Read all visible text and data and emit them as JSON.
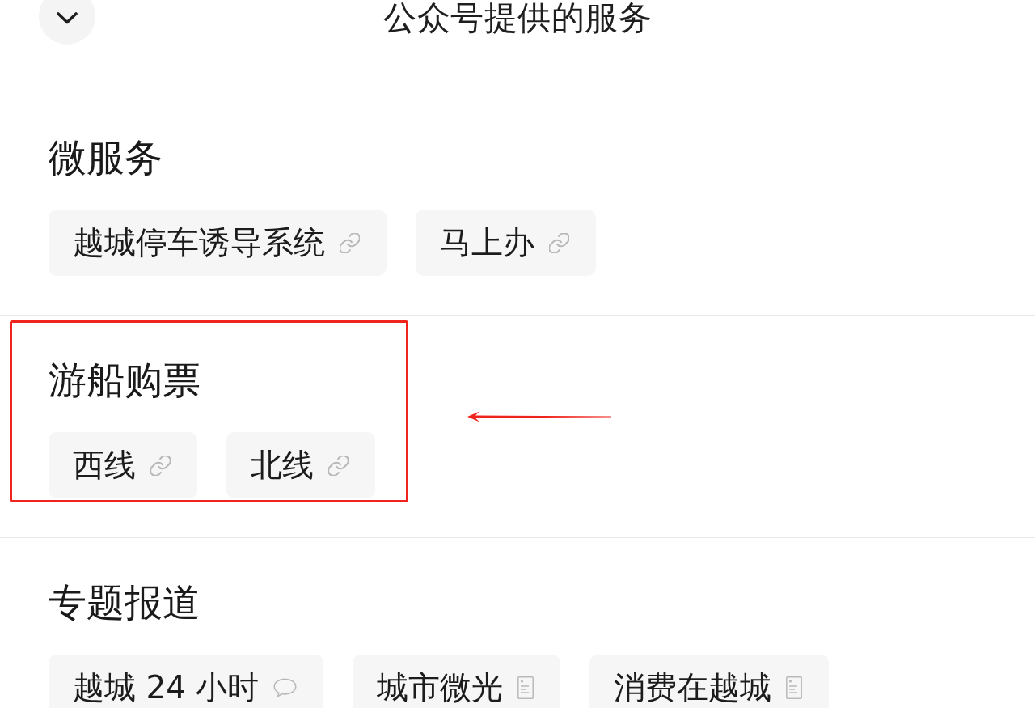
{
  "header": {
    "title": "公众号提供的服务"
  },
  "sections": [
    {
      "title": "微服务",
      "highlighted": false,
      "items": [
        {
          "label": "越城停车诱导系统",
          "kind": "link"
        },
        {
          "label": "马上办",
          "kind": "link"
        }
      ]
    },
    {
      "title": "游船购票",
      "highlighted": true,
      "items": [
        {
          "label": "西线",
          "kind": "link"
        },
        {
          "label": "北线",
          "kind": "link"
        }
      ]
    },
    {
      "title": "专题报道",
      "highlighted": false,
      "items": [
        {
          "label": "越城 24 小时",
          "kind": "comment"
        },
        {
          "label": "城市微光",
          "kind": "article"
        },
        {
          "label": "消费在越城",
          "kind": "article"
        }
      ]
    }
  ]
}
